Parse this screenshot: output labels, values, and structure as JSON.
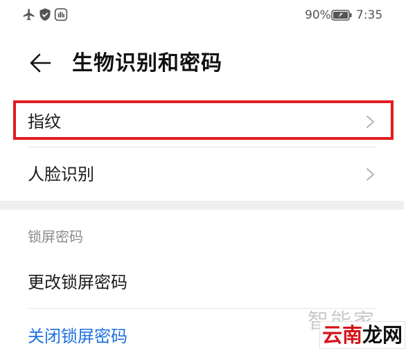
{
  "status_bar": {
    "icons": [
      "airplane-icon",
      "shield-icon",
      "hand-icon",
      "battery-icon"
    ],
    "battery_percent": "90%",
    "time": "7:35"
  },
  "header": {
    "back_icon": "back-arrow-icon",
    "title": "生物识别和密码"
  },
  "biometrics": {
    "items": [
      {
        "label": "指纹",
        "icon": "chevron-right-icon",
        "highlighted": true
      },
      {
        "label": "人脸识别",
        "icon": "chevron-right-icon"
      }
    ]
  },
  "lock_screen": {
    "section_title": "锁屏密码",
    "change_label": "更改锁屏密码",
    "disable_label": "关闭锁屏密码"
  },
  "watermark": {
    "top_text": "智能家",
    "part1": "云南",
    "part2": "龙网"
  },
  "colors": {
    "highlight": "#e11b22",
    "accent": "#1e6fe0",
    "divider": "#e6e6e6",
    "section_gap": "#efefef",
    "secondary_text": "#8a8a8a"
  }
}
